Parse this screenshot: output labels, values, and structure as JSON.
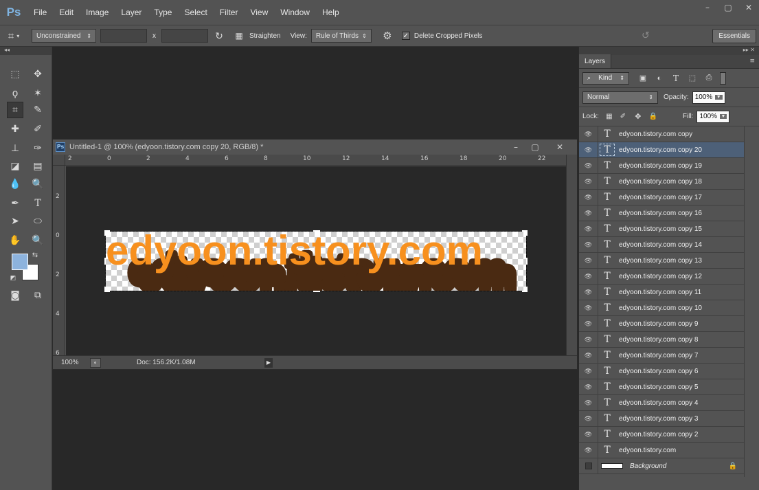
{
  "app": {
    "logo": "Ps"
  },
  "menu": [
    "File",
    "Edit",
    "Image",
    "Layer",
    "Type",
    "Select",
    "Filter",
    "View",
    "Window",
    "Help"
  ],
  "window_controls": {
    "minimize": "–",
    "restore": "▢",
    "close": "✕"
  },
  "options": {
    "ratio": "Unconstrained",
    "times": "x",
    "straighten": "Straighten",
    "view_label": "View:",
    "view_value": "Rule of Thirds",
    "delete_cropped": "Delete Cropped Pixels",
    "delete_cropped_checked": true,
    "workspace": "Essentials"
  },
  "document": {
    "title": "Untitled-1 @ 100% (edyoon.tistory.com copy 20, RGB/8) *",
    "ps_badge": "Ps",
    "zoom": "100%",
    "doc_info": "Doc: 156.2K/1.08M",
    "canvas_text": "edyoon.tistory.com",
    "text_color": "#f7901e",
    "shadow_color": "#4a2a12",
    "ruler_h": [
      "2",
      "0",
      "2",
      "4",
      "6",
      "8",
      "10",
      "12",
      "14",
      "16",
      "18",
      "20",
      "22"
    ],
    "ruler_v": [
      "2",
      "0",
      "2",
      "4",
      "6"
    ]
  },
  "toolbox": {
    "foreground_color": "#8db3dd",
    "background_color": "#ffffff"
  },
  "layers_panel": {
    "tab": "Layers",
    "filter_kind": "Kind",
    "blend_mode": "Normal",
    "opacity_label": "Opacity:",
    "opacity": "100%",
    "lock_label": "Lock:",
    "fill_label": "Fill:",
    "fill": "100%",
    "layers": [
      {
        "name": "edyoon.tistory.com copy",
        "selected": false
      },
      {
        "name": "edyoon.tistory.com copy 20",
        "selected": true
      },
      {
        "name": "edyoon.tistory.com copy 19",
        "selected": false
      },
      {
        "name": "edyoon.tistory.com copy 18",
        "selected": false
      },
      {
        "name": "edyoon.tistory.com copy 17",
        "selected": false
      },
      {
        "name": "edyoon.tistory.com copy 16",
        "selected": false
      },
      {
        "name": "edyoon.tistory.com copy 15",
        "selected": false
      },
      {
        "name": "edyoon.tistory.com copy 14",
        "selected": false
      },
      {
        "name": "edyoon.tistory.com copy 13",
        "selected": false
      },
      {
        "name": "edyoon.tistory.com copy 12",
        "selected": false
      },
      {
        "name": "edyoon.tistory.com copy 11",
        "selected": false
      },
      {
        "name": "edyoon.tistory.com copy 10",
        "selected": false
      },
      {
        "name": "edyoon.tistory.com copy 9",
        "selected": false
      },
      {
        "name": "edyoon.tistory.com copy 8",
        "selected": false
      },
      {
        "name": "edyoon.tistory.com copy 7",
        "selected": false
      },
      {
        "name": "edyoon.tistory.com copy 6",
        "selected": false
      },
      {
        "name": "edyoon.tistory.com copy 5",
        "selected": false
      },
      {
        "name": "edyoon.tistory.com copy 4",
        "selected": false
      },
      {
        "name": "edyoon.tistory.com copy 3",
        "selected": false
      },
      {
        "name": "edyoon.tistory.com copy 2",
        "selected": false
      },
      {
        "name": "edyoon.tistory.com",
        "selected": false
      }
    ],
    "background_layer": "Background"
  }
}
